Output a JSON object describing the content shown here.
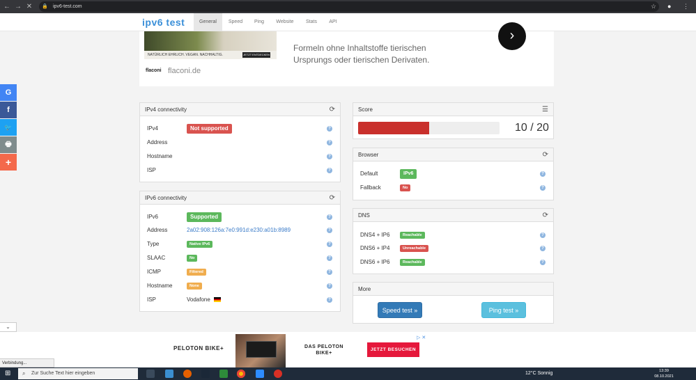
{
  "browser": {
    "back_icon": "←",
    "forward_icon": "→",
    "reload_icon": "✕",
    "url": "ipv6-test.com",
    "lock_icon": "🔒",
    "star_icon": "☆",
    "profile_icon": "●",
    "menu_icon": "⋮"
  },
  "site": {
    "logo": "ipv6 test",
    "tabs": [
      "General",
      "Speed",
      "Ping",
      "Website",
      "Stats",
      "API"
    ],
    "active_tab": "General"
  },
  "ad_top": {
    "image_text": "NATÜRLICH EHRLICH. VEGAN. NACHHALTIG.",
    "image_button": "JETZT ENTDECKEN",
    "brand": "flaconi",
    "domain": "flaconi.de",
    "text": "Formeln ohne Inhaltstoffe tierischen Ursprungs oder tierischen Derivaten.",
    "arrow_icon": "›"
  },
  "social": [
    {
      "icon": "G",
      "color": "#4285f4"
    },
    {
      "icon": "f",
      "color": "#3b5998"
    },
    {
      "icon": "🐦",
      "color": "#1da1f2"
    },
    {
      "icon": "🖶",
      "color": "#7f8c8d"
    },
    {
      "icon": "+",
      "color": "#f4694b"
    }
  ],
  "ipv4": {
    "title": "IPv4 connectivity",
    "refresh_icon": "⟳",
    "rows": [
      {
        "label": "IPv4",
        "status": "Not supported"
      },
      {
        "label": "Address"
      },
      {
        "label": "Hostname"
      },
      {
        "label": "ISP"
      }
    ]
  },
  "ipv6": {
    "title": "IPv6 connectivity",
    "refresh_icon": "⟳",
    "rows": [
      {
        "label": "IPv6",
        "status": "Supported"
      },
      {
        "label": "Address",
        "value": "2a02:908:126a:7e0:991d:e230:a01b:8989"
      },
      {
        "label": "Type",
        "status": "Native IPv6"
      },
      {
        "label": "SLAAC",
        "status": "No"
      },
      {
        "label": "ICMP",
        "status": "Filtered"
      },
      {
        "label": "Hostname",
        "status": "None"
      },
      {
        "label": "ISP",
        "value": "Vodafone",
        "flag": "de-flag"
      }
    ]
  },
  "help_icon": "?",
  "score": {
    "title": "Score",
    "list_icon": "☰",
    "value": 10,
    "max": 20,
    "text": "10 / 20"
  },
  "browser_panel": {
    "title": "Browser",
    "refresh_icon": "⟳",
    "rows": [
      {
        "label": "Default",
        "status": "IPv6"
      },
      {
        "label": "Fallback",
        "status": "No"
      }
    ]
  },
  "dns": {
    "title": "DNS",
    "refresh_icon": "⟳",
    "rows": [
      {
        "label": "DNS4 + IP6",
        "status": "Reachable"
      },
      {
        "label": "DNS6 + IP4",
        "status": "Unreachable"
      },
      {
        "label": "DNS6 + IP6",
        "status": "Reachable"
      }
    ]
  },
  "more": {
    "title": "More",
    "speed_button": "Speed test »",
    "ping_button": "Ping test »"
  },
  "ad_bottom": {
    "logo": "PELOTON BIKE+",
    "title": "DAS PELOTON BIKE+",
    "button": "JETZT BESUCHEN",
    "choice_icon": "▷ ✕",
    "collapse_icon": "⌄"
  },
  "status_text": "Verbindung...",
  "taskbar": {
    "start_icon": "⊞",
    "search_icon": "⌕",
    "search_placeholder": "Zur Suche Text hier eingeben",
    "weather": "12°C  Sonnig",
    "time": "13:39",
    "date": "08.10.2021"
  },
  "colors": {
    "red": "#d9534f",
    "green": "#5cb85c",
    "orange": "#f0ad4e",
    "link": "#3a7bc8",
    "primary_button": "#337ab7",
    "info_button": "#5bc0de"
  }
}
